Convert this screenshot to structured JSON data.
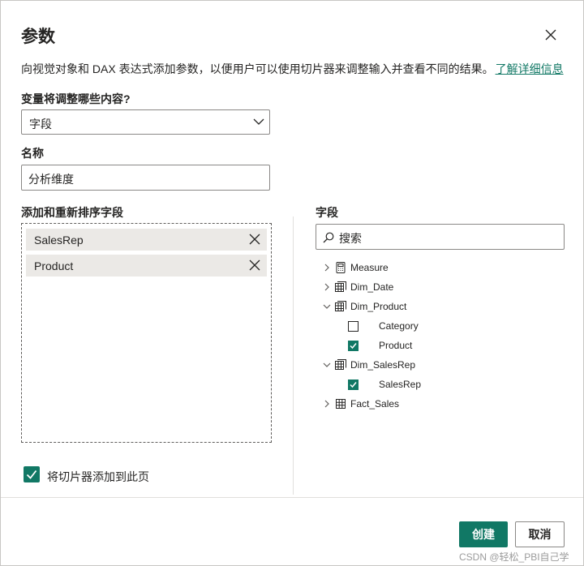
{
  "dialog": {
    "title": "参数",
    "description": "向视觉对象和 DAX 表达式添加参数，以便用户可以使用切片器来调整输入并查看不同的结果。",
    "learn_more": "了解详细信息"
  },
  "variable": {
    "label": "变量将调整哪些内容?",
    "selected": "字段"
  },
  "name": {
    "label": "名称",
    "value": "分析维度"
  },
  "fields_well": {
    "label": "添加和重新排序字段",
    "items": [
      {
        "label": "SalesRep"
      },
      {
        "label": "Product"
      }
    ]
  },
  "fields_pane": {
    "label": "字段",
    "search_placeholder": "搜索",
    "tree": [
      {
        "label": "Measure",
        "icon": "calculator-icon",
        "expanded": false
      },
      {
        "label": "Dim_Date",
        "icon": "table-icon",
        "expanded": false
      },
      {
        "label": "Dim_Product",
        "icon": "table-icon",
        "expanded": true
      },
      {
        "label": "Category",
        "checked": false
      },
      {
        "label": "Product",
        "checked": true
      },
      {
        "label": "Dim_SalesRep",
        "icon": "table-icon",
        "expanded": true
      },
      {
        "label": "SalesRep",
        "checked": true
      },
      {
        "label": "Fact_Sales",
        "icon": "grid-icon",
        "expanded": false
      }
    ]
  },
  "add_slicer": {
    "label": "将切片器添加到此页",
    "checked": true
  },
  "buttons": {
    "create": "创建",
    "cancel": "取消"
  },
  "watermark": "CSDN @轻松_PBI自己学",
  "colors": {
    "accent": "#117865",
    "text": "#252423",
    "border": "#8a8886"
  }
}
